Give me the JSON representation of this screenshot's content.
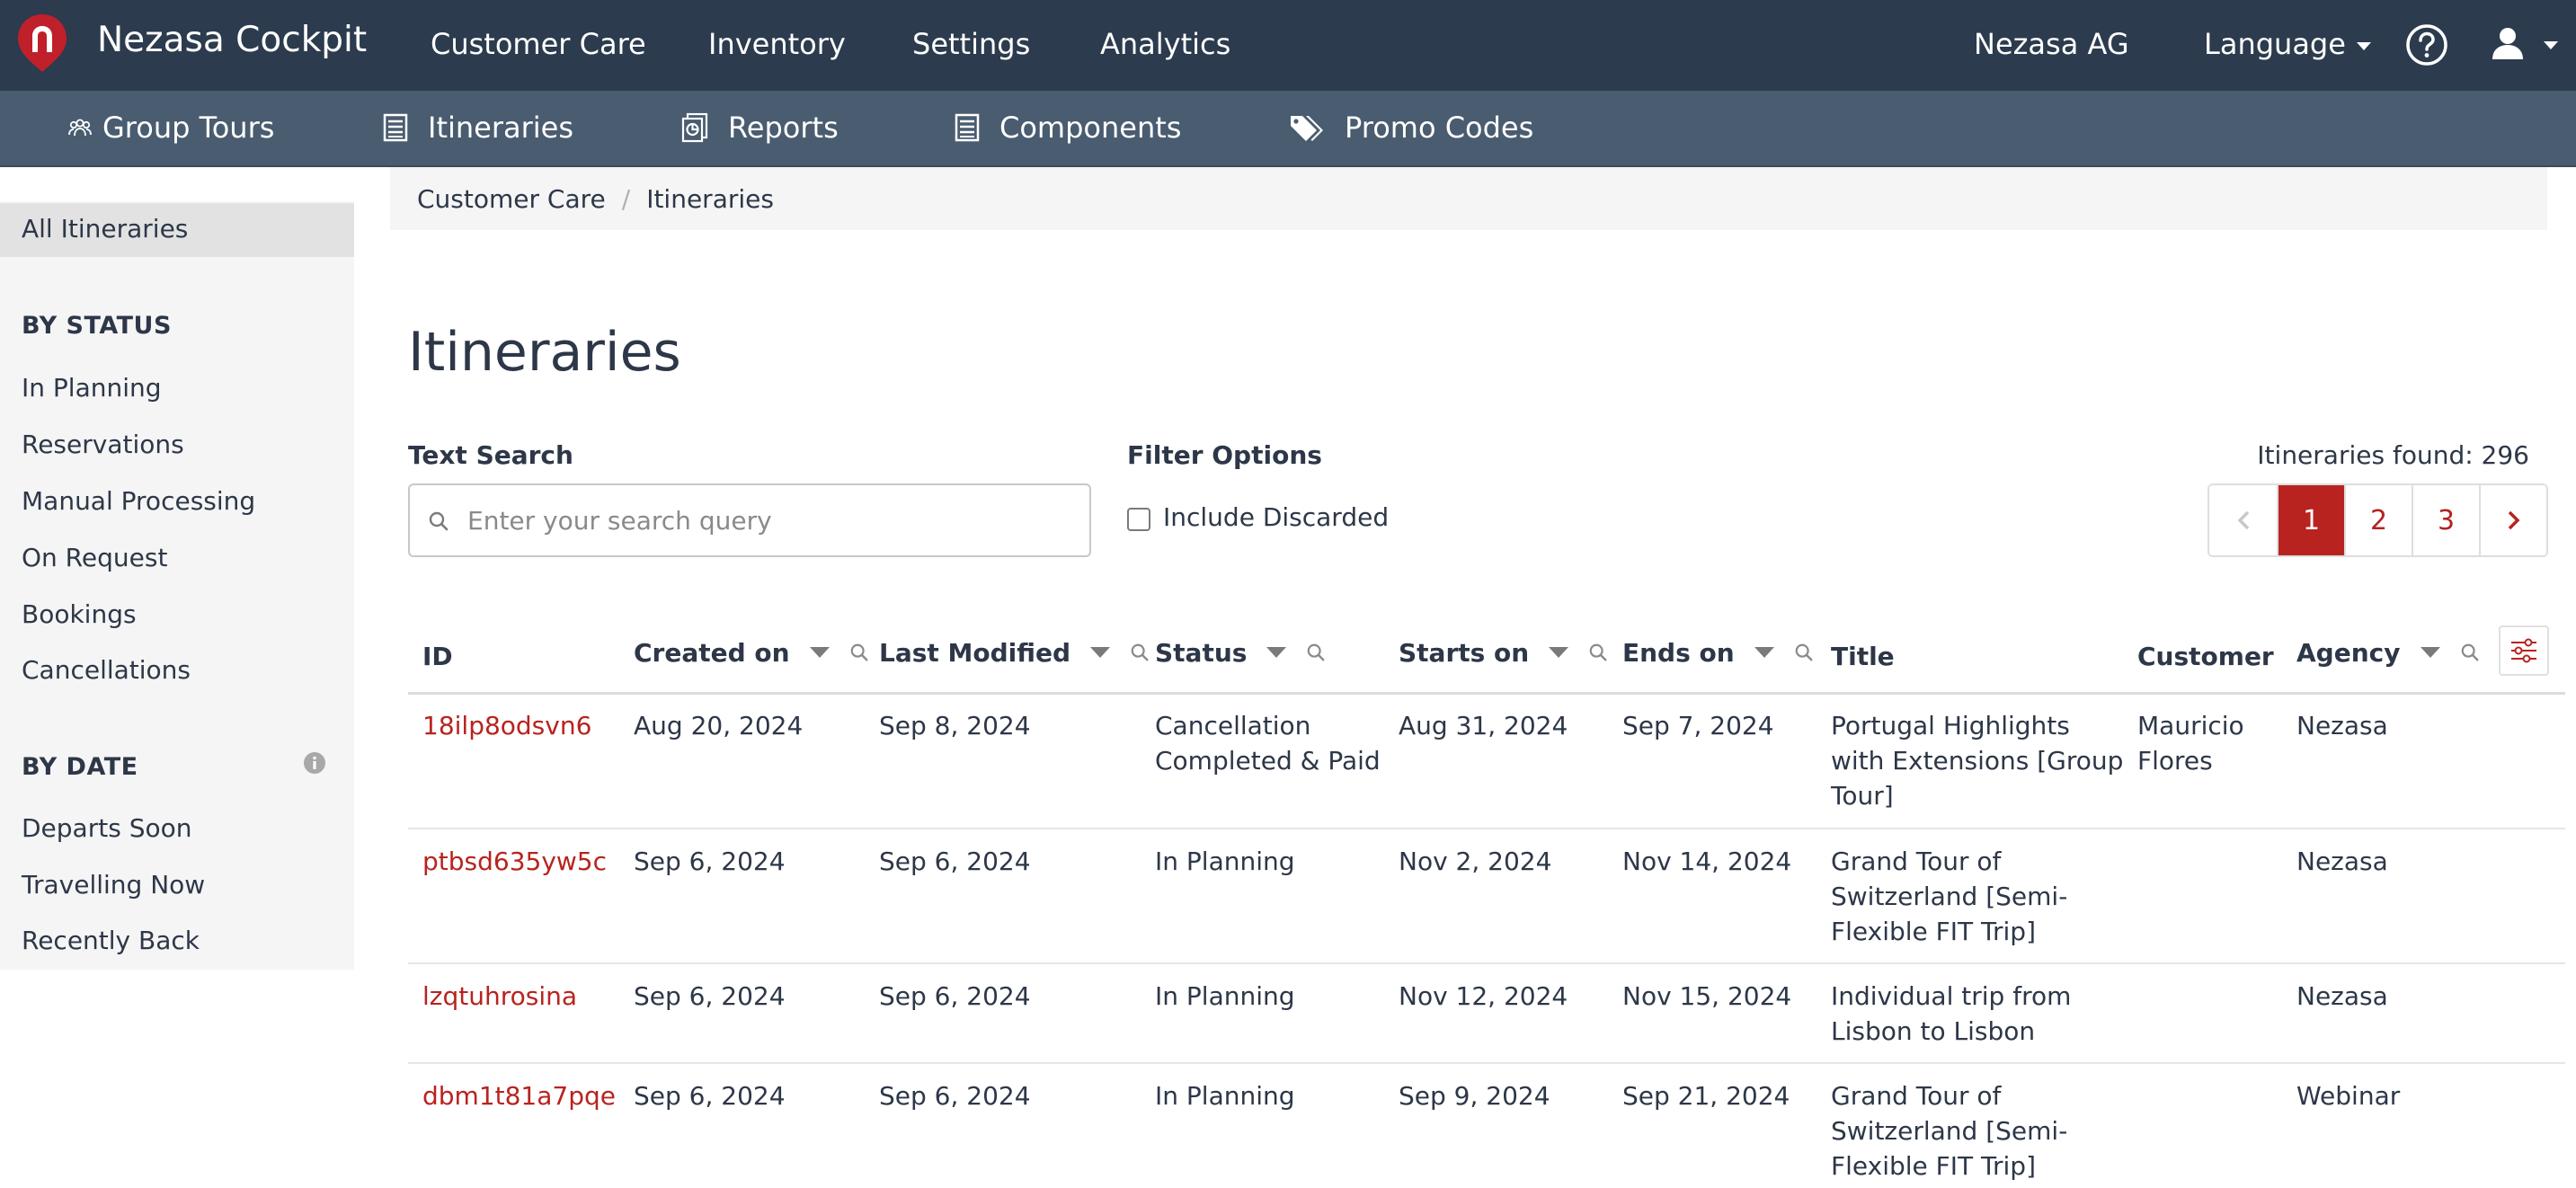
{
  "app": {
    "title": "Nezasa Cockpit"
  },
  "topnav": {
    "items": [
      "Customer Care",
      "Inventory",
      "Settings",
      "Analytics"
    ],
    "company": "Nezasa AG",
    "language": "Language"
  },
  "subnav": {
    "items": [
      "Group Tours",
      "Itineraries",
      "Reports",
      "Components",
      "Promo Codes"
    ]
  },
  "sidebar": {
    "active": "All Itineraries",
    "by_status_heading": "BY STATUS",
    "status_items": [
      "In Planning",
      "Reservations",
      "Manual Processing",
      "On Request",
      "Bookings",
      "Cancellations"
    ],
    "by_date_heading": "BY DATE",
    "date_items": [
      "Departs Soon",
      "Travelling Now",
      "Recently Back"
    ]
  },
  "breadcrumb": [
    "Customer Care",
    "Itineraries"
  ],
  "page": {
    "title": "Itineraries",
    "text_search_label": "Text Search",
    "search_placeholder": "Enter your search query",
    "filter_label": "Filter Options",
    "include_discarded": "Include Discarded",
    "found": "Itineraries found: 296"
  },
  "pagination": {
    "pages": [
      "1",
      "2",
      "3"
    ],
    "current": "1"
  },
  "table": {
    "columns": [
      "ID",
      "Created on",
      "Last Modified",
      "Status",
      "Starts on",
      "Ends on",
      "Title",
      "Customer",
      "Agency"
    ],
    "rows": [
      {
        "id": "18ilp8odsvn6",
        "created": "Aug 20, 2024",
        "modified": "Sep 8, 2024",
        "status": [
          "Cancellation",
          "Completed & Paid"
        ],
        "starts": "Aug 31, 2024",
        "ends": "Sep 7, 2024",
        "title": [
          "Portugal Highlights",
          "with Extensions [Group",
          "Tour]"
        ],
        "customer": [
          "Mauricio",
          "Flores"
        ],
        "agency": "Nezasa"
      },
      {
        "id": "ptbsd635yw5c",
        "created": "Sep 6, 2024",
        "modified": "Sep 6, 2024",
        "status": [
          "In Planning"
        ],
        "starts": "Nov 2, 2024",
        "ends": "Nov 14, 2024",
        "title": [
          "Grand Tour of",
          "Switzerland [Semi-",
          "Flexible FIT Trip]"
        ],
        "customer": [],
        "agency": "Nezasa"
      },
      {
        "id": "lzqtuhrosina",
        "created": "Sep 6, 2024",
        "modified": "Sep 6, 2024",
        "status": [
          "In Planning"
        ],
        "starts": "Nov 12, 2024",
        "ends": "Nov 15, 2024",
        "title": [
          "Individual trip from",
          "Lisbon to Lisbon"
        ],
        "customer": [],
        "agency": "Nezasa"
      },
      {
        "id": "dbm1t81a7pqe",
        "created": "Sep 6, 2024",
        "modified": "Sep 6, 2024",
        "status": [
          "In Planning"
        ],
        "starts": "Sep 9, 2024",
        "ends": "Sep 21, 2024",
        "title": [
          "Grand Tour of",
          "Switzerland [Semi-",
          "Flexible FIT Trip]"
        ],
        "customer": [],
        "agency": "Webinar"
      }
    ]
  },
  "colors": {
    "topbar": "#2c3b4e",
    "subbar": "#4a5c70",
    "accent": "#b8231f"
  },
  "icons": [
    "map-pin-logo-icon",
    "help-circle-icon",
    "user-icon",
    "group-icon",
    "list-icon",
    "report-icon",
    "tags-icon",
    "info-icon",
    "search-icon",
    "sort-caret-icon",
    "chevron-left-icon",
    "chevron-right-icon",
    "column-settings-icon"
  ]
}
